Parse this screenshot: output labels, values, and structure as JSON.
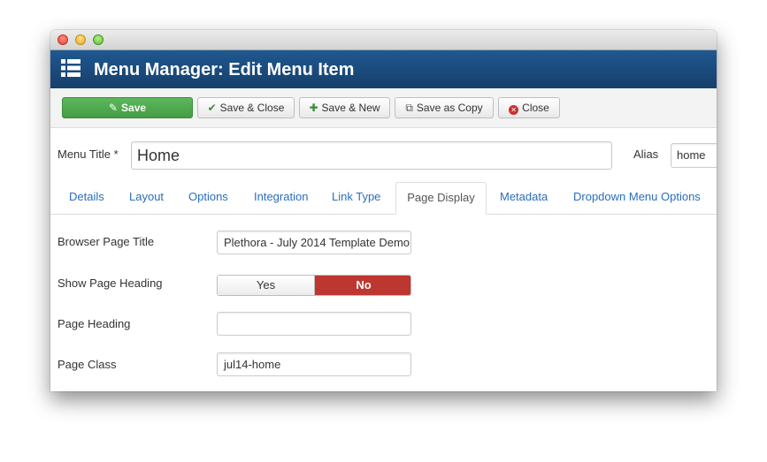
{
  "header": {
    "title": "Menu Manager: Edit Menu Item",
    "icon": "list-icon"
  },
  "toolbar": {
    "save_label": "Save",
    "save_close_label": "Save & Close",
    "save_new_label": "Save & New",
    "save_copy_label": "Save as Copy",
    "close_label": "Close"
  },
  "form": {
    "menu_title_label": "Menu Title *",
    "menu_title_value": "Home",
    "alias_label": "Alias",
    "alias_value": "home"
  },
  "tabs": [
    {
      "label": "Details"
    },
    {
      "label": "Layout"
    },
    {
      "label": "Options"
    },
    {
      "label": "Integration"
    },
    {
      "label": "Link Type"
    },
    {
      "label": "Page Display"
    },
    {
      "label": "Metadata"
    },
    {
      "label": "Dropdown Menu Options"
    }
  ],
  "active_tab": "Page Display",
  "page_display": {
    "browser_page_title_label": "Browser Page Title",
    "browser_page_title_value": "Plethora - July 2014 Template Demo",
    "show_page_heading_label": "Show Page Heading",
    "show_page_heading_yes": "Yes",
    "show_page_heading_no": "No",
    "show_page_heading_selected": "No",
    "page_heading_label": "Page Heading",
    "page_heading_value": "",
    "page_class_label": "Page Class",
    "page_class_value": "jul14-home"
  },
  "colors": {
    "header_bg": "#1a4c7f",
    "save_green": "#4cae4c",
    "toggle_no_red": "#bd362f",
    "tab_link": "#2a6ebb"
  }
}
